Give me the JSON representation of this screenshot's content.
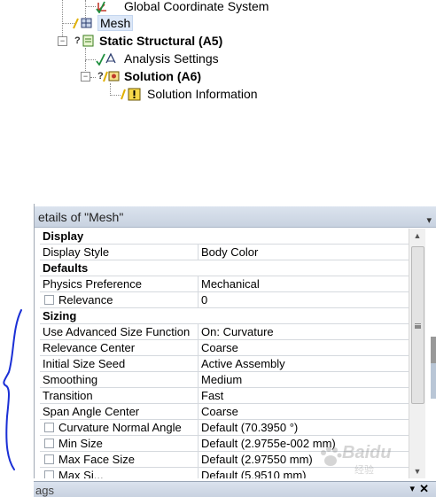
{
  "tree": {
    "items": [
      {
        "label": "Global Coordinate System",
        "bold": false
      },
      {
        "label": "Mesh",
        "bold": false,
        "selected": true
      },
      {
        "label": "Static Structural (A5)",
        "bold": true
      },
      {
        "label": "Analysis Settings",
        "bold": false
      },
      {
        "label": "Solution (A6)",
        "bold": true
      },
      {
        "label": "Solution Information",
        "bold": false
      }
    ],
    "question_mark": "?",
    "expander_minus": "−"
  },
  "details": {
    "title": "etails of \"Mesh\"",
    "pin": "▾",
    "rows": [
      {
        "kind": "cat",
        "name": "Display"
      },
      {
        "kind": "prop",
        "name": "Display Style",
        "value": "Body Color"
      },
      {
        "kind": "cat",
        "name": "Defaults"
      },
      {
        "kind": "prop",
        "name": "Physics Preference",
        "value": "Mechanical"
      },
      {
        "kind": "check",
        "name": "Relevance",
        "value": "0"
      },
      {
        "kind": "cat",
        "name": "Sizing"
      },
      {
        "kind": "prop",
        "name": "Use Advanced Size Function",
        "value": "On: Curvature"
      },
      {
        "kind": "prop",
        "name": "Relevance Center",
        "value": "Coarse"
      },
      {
        "kind": "prop",
        "name": "Initial Size Seed",
        "value": "Active Assembly"
      },
      {
        "kind": "prop",
        "name": "Smoothing",
        "value": "Medium"
      },
      {
        "kind": "prop",
        "name": "Transition",
        "value": "Fast"
      },
      {
        "kind": "prop",
        "name": "Span Angle Center",
        "value": "Coarse"
      },
      {
        "kind": "check",
        "name": "Curvature Normal Angle",
        "value": "Default (70.3950 °)"
      },
      {
        "kind": "check",
        "name": "Min Size",
        "value": "Default (2.9755e-002 mm)"
      },
      {
        "kind": "check",
        "name": "Max Face Size",
        "value": "Default (2.97550 mm)"
      },
      {
        "kind": "check",
        "name": "Max Si...",
        "value": "Default (5.9510 mm)"
      }
    ],
    "scroll_up": "▲",
    "scroll_down": "▼"
  },
  "bottom_panel": {
    "title": "ags",
    "pin": "▾",
    "close": "✕"
  },
  "watermark": {
    "brand": "Baidu",
    "sub": "经验"
  },
  "colors": {
    "panel_header": "#c8d2e0",
    "selection": "#dde8f8",
    "annotation_ink": "#1a2fd6"
  }
}
